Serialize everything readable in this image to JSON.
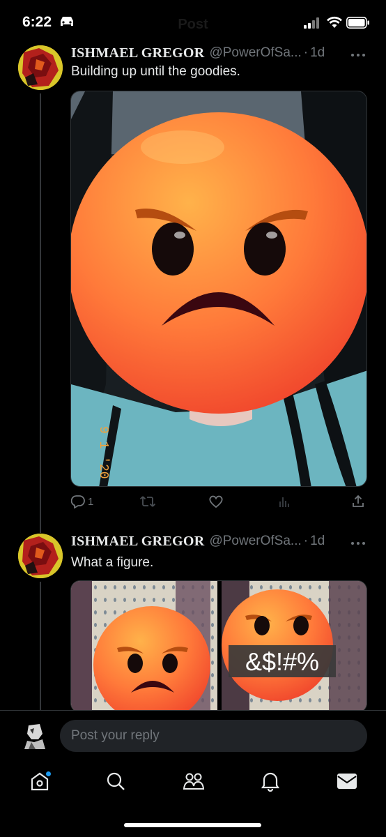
{
  "status_bar": {
    "time": "6:22",
    "header_title": "Post",
    "icons": [
      "car-icon",
      "signal-icon",
      "wifi-icon",
      "battery-icon"
    ]
  },
  "tweets": [
    {
      "author_name": "ISHMAEL GREGOR",
      "handle": "@PowerOfSa...",
      "separator": "·",
      "time": "1d",
      "text": "Building up until the goodies.",
      "media_stamp": "9 1 '20",
      "reply_count": "1",
      "icons": [
        "reply-icon",
        "retweet-icon",
        "like-icon",
        "views-icon",
        "share-icon"
      ]
    },
    {
      "author_name": "ISHMAEL GREGOR",
      "handle": "@PowerOfSa...",
      "separator": "·",
      "time": "1d",
      "text": "What a figure.",
      "censor_text": "&$!#%"
    }
  ],
  "reply_bar": {
    "placeholder": "Post your reply"
  },
  "bottom_nav": {
    "items": [
      "home-icon",
      "search-icon",
      "communities-icon",
      "notifications-icon",
      "messages-icon"
    ],
    "home_has_badge": true
  },
  "colors": {
    "background": "#000000",
    "text": "#e7e9ea",
    "muted": "#71767b",
    "accent": "#1d9bf0",
    "input_bg": "#202327"
  }
}
